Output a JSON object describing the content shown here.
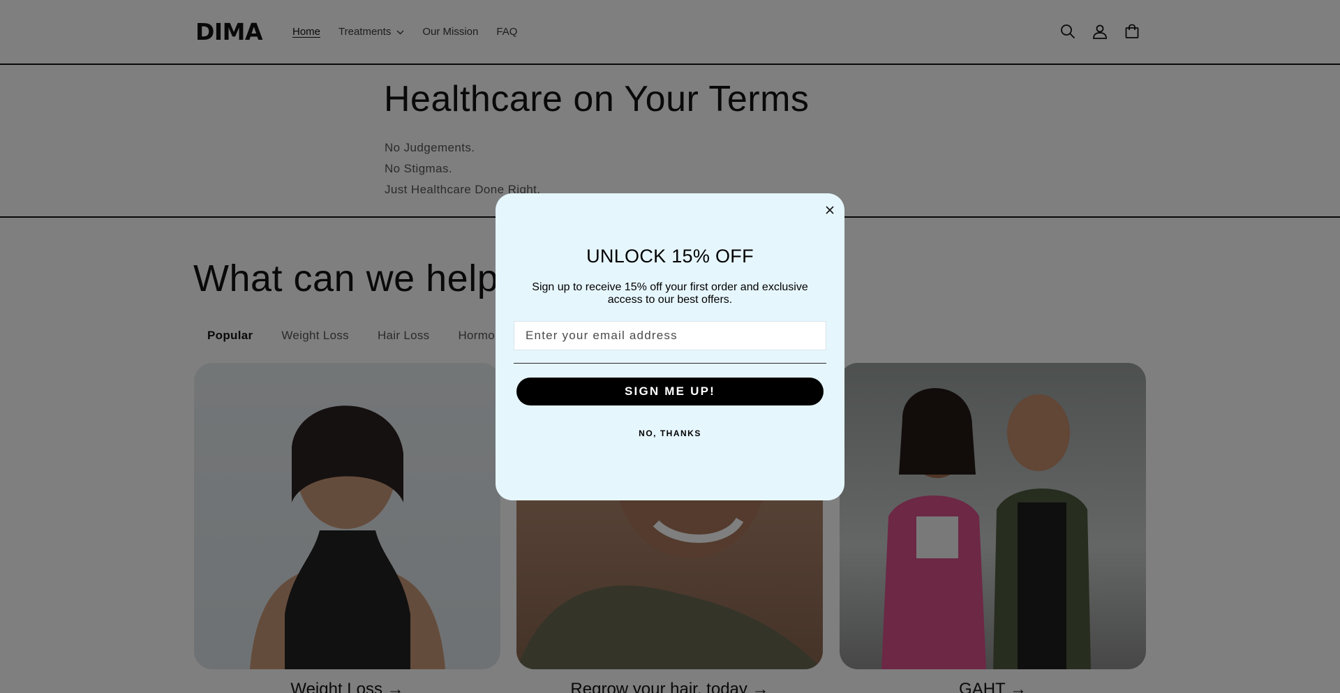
{
  "header": {
    "logo": "DIMA",
    "nav": [
      {
        "label": "Home"
      },
      {
        "label": "Treatments"
      },
      {
        "label": "Our Mission"
      },
      {
        "label": "FAQ"
      }
    ],
    "icons": [
      "search-icon",
      "account-icon",
      "cart-icon"
    ]
  },
  "hero": {
    "title": "Healthcare on Your Terms",
    "lines": [
      "No Judgements.",
      "No Stigmas.",
      "Just Healthcare Done Right."
    ]
  },
  "section": {
    "title": "What can we help you with?",
    "tabs": [
      "Popular",
      "Weight Loss",
      "Hair Loss",
      "Hormones"
    ],
    "cards": [
      {
        "caption": "Weight Loss →"
      },
      {
        "caption": "Regrow your hair, today →"
      },
      {
        "caption": "GAHT →"
      }
    ]
  },
  "modal": {
    "title": "UNLOCK 15% OFF",
    "subtitle": "Sign up to receive 15% off your first order and exclusive access to our best offers.",
    "email_placeholder": "Enter your email address",
    "email_value": "",
    "signup_label": "SIGN ME UP!",
    "decline_label": "NO, THANKS"
  },
  "colors": {
    "overlay": "rgba(0,0,0,0.5)",
    "modal_bg": "#e6f6fd",
    "button_bg": "#000000",
    "text": "#121212"
  }
}
